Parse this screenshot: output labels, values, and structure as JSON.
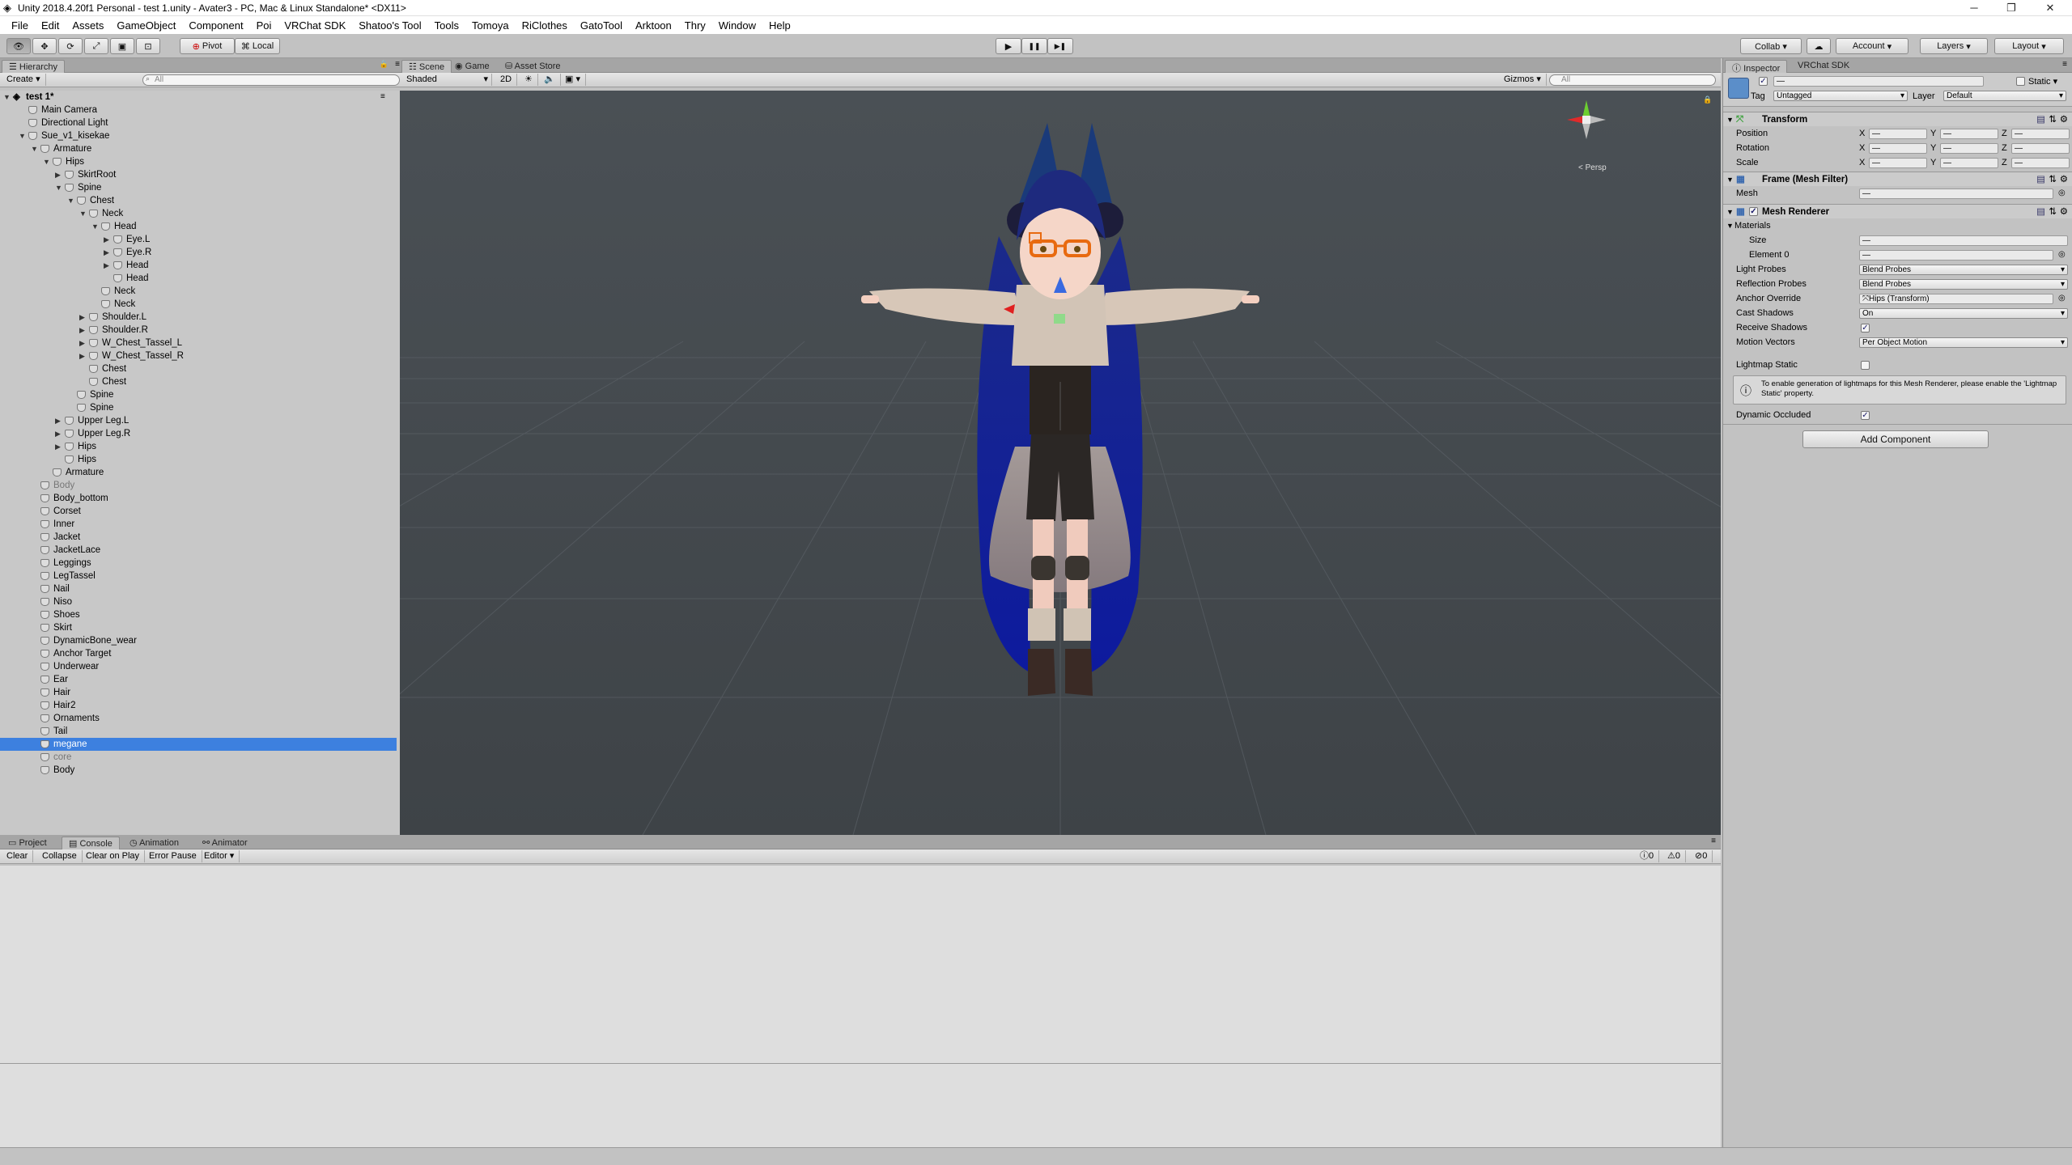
{
  "window": {
    "title": "Unity 2018.4.20f1 Personal - test 1.unity - Avater3 - PC, Mac & Linux Standalone* <DX11>",
    "minimize": "─",
    "maximize": "❐",
    "close": "✕"
  },
  "menu": [
    "File",
    "Edit",
    "Assets",
    "GameObject",
    "Component",
    "Poi",
    "VRChat SDK",
    "Shatoo's Tool",
    "Tools",
    "Tomoya",
    "RiClothes",
    "GatoTool",
    "Arktoon",
    "Thry",
    "Window",
    "Help"
  ],
  "toolbar": {
    "pivot": "Pivot",
    "local": "Local",
    "collab": "Collab ▾",
    "account": "Account",
    "layers": "Layers",
    "layout": "Layout",
    "play": "▶",
    "pause": "❚❚",
    "step": "▶❚"
  },
  "hierarchy": {
    "tab": "Hierarchy",
    "create": "Create ▾",
    "search": "All",
    "scene": "test 1*",
    "items": [
      {
        "label": "Main Camera",
        "depth": 1,
        "arrow": ""
      },
      {
        "label": "Directional Light",
        "depth": 1,
        "arrow": ""
      },
      {
        "label": "Sue_v1_kisekae",
        "depth": 1,
        "arrow": "▼"
      },
      {
        "label": "Armature",
        "depth": 2,
        "arrow": "▼"
      },
      {
        "label": "Hips",
        "depth": 3,
        "arrow": "▼"
      },
      {
        "label": "SkirtRoot",
        "depth": 4,
        "arrow": "▶"
      },
      {
        "label": "Spine",
        "depth": 4,
        "arrow": "▼"
      },
      {
        "label": "Chest",
        "depth": 5,
        "arrow": "▼"
      },
      {
        "label": "Neck",
        "depth": 6,
        "arrow": "▼"
      },
      {
        "label": "Head",
        "depth": 7,
        "arrow": "▼"
      },
      {
        "label": "Eye.L",
        "depth": 8,
        "arrow": "▶"
      },
      {
        "label": "Eye.R",
        "depth": 8,
        "arrow": "▶"
      },
      {
        "label": "Head",
        "depth": 8,
        "arrow": "▶"
      },
      {
        "label": "Head",
        "depth": 8,
        "arrow": ""
      },
      {
        "label": "Neck",
        "depth": 7,
        "arrow": ""
      },
      {
        "label": "Neck",
        "depth": 7,
        "arrow": ""
      },
      {
        "label": "Shoulder.L",
        "depth": 6,
        "arrow": "▶"
      },
      {
        "label": "Shoulder.R",
        "depth": 6,
        "arrow": "▶"
      },
      {
        "label": "W_Chest_Tassel_L",
        "depth": 6,
        "arrow": "▶"
      },
      {
        "label": "W_Chest_Tassel_R",
        "depth": 6,
        "arrow": "▶"
      },
      {
        "label": "Chest",
        "depth": 6,
        "arrow": ""
      },
      {
        "label": "Chest",
        "depth": 6,
        "arrow": ""
      },
      {
        "label": "Spine",
        "depth": 5,
        "arrow": ""
      },
      {
        "label": "Spine",
        "depth": 5,
        "arrow": ""
      },
      {
        "label": "Upper Leg.L",
        "depth": 4,
        "arrow": "▶"
      },
      {
        "label": "Upper Leg.R",
        "depth": 4,
        "arrow": "▶"
      },
      {
        "label": "Hips",
        "depth": 4,
        "arrow": "▶"
      },
      {
        "label": "Hips",
        "depth": 4,
        "arrow": ""
      },
      {
        "label": "Armature",
        "depth": 3,
        "arrow": ""
      },
      {
        "label": "Body",
        "depth": 2,
        "arrow": "",
        "dim": true
      },
      {
        "label": "Body_bottom",
        "depth": 2,
        "arrow": ""
      },
      {
        "label": "Corset",
        "depth": 2,
        "arrow": ""
      },
      {
        "label": "Inner",
        "depth": 2,
        "arrow": ""
      },
      {
        "label": "Jacket",
        "depth": 2,
        "arrow": ""
      },
      {
        "label": "JacketLace",
        "depth": 2,
        "arrow": ""
      },
      {
        "label": "Leggings",
        "depth": 2,
        "arrow": ""
      },
      {
        "label": "LegTassel",
        "depth": 2,
        "arrow": ""
      },
      {
        "label": "Nail",
        "depth": 2,
        "arrow": ""
      },
      {
        "label": "Niso",
        "depth": 2,
        "arrow": ""
      },
      {
        "label": "Shoes",
        "depth": 2,
        "arrow": ""
      },
      {
        "label": "Skirt",
        "depth": 2,
        "arrow": ""
      },
      {
        "label": "DynamicBone_wear",
        "depth": 2,
        "arrow": ""
      },
      {
        "label": "Anchor Target",
        "depth": 2,
        "arrow": ""
      },
      {
        "label": "Underwear",
        "depth": 2,
        "arrow": ""
      },
      {
        "label": "Ear",
        "depth": 2,
        "arrow": ""
      },
      {
        "label": "Hair",
        "depth": 2,
        "arrow": ""
      },
      {
        "label": "Hair2",
        "depth": 2,
        "arrow": ""
      },
      {
        "label": "Ornaments",
        "depth": 2,
        "arrow": ""
      },
      {
        "label": "Tail",
        "depth": 2,
        "arrow": ""
      },
      {
        "label": "megane",
        "depth": 2,
        "arrow": "",
        "selected": true
      },
      {
        "label": "core",
        "depth": 2,
        "arrow": "",
        "dim": true
      },
      {
        "label": "Body",
        "depth": 2,
        "arrow": ""
      }
    ]
  },
  "scene": {
    "tabs": [
      "Scene",
      "Game",
      "Asset Store"
    ],
    "shading": "Shaded",
    "mode2d": "2D",
    "gizmos": "Gizmos ▾",
    "search": "All",
    "persp": "< Persp"
  },
  "inspector": {
    "tabs": [
      "Inspector",
      "VRChat SDK"
    ],
    "name_value": "—",
    "static": "Static ▾",
    "tag_label": "Tag",
    "tag_value": "Untagged",
    "layer_label": "Layer",
    "layer_value": "Default",
    "transform": {
      "title": "Transform",
      "rows": [
        {
          "label": "Position",
          "x": "—",
          "y": "—",
          "z": "—"
        },
        {
          "label": "Rotation",
          "x": "—",
          "y": "—",
          "z": "—"
        },
        {
          "label": "Scale",
          "x": "—",
          "y": "—",
          "z": "—"
        }
      ]
    },
    "mesh_filter": {
      "title": "Frame (Mesh Filter)",
      "mesh_label": "Mesh",
      "mesh_value": "—"
    },
    "mesh_renderer": {
      "title": "Mesh Renderer",
      "materials": "Materials",
      "size_label": "Size",
      "size_value": "—",
      "element0_label": "Element 0",
      "element0_value": "—",
      "light_probes_label": "Light Probes",
      "light_probes_value": "Blend Probes",
      "reflection_probes_label": "Reflection Probes",
      "reflection_probes_value": "Blend Probes",
      "anchor_label": "Anchor Override",
      "anchor_value": "Hips (Transform)",
      "cast_label": "Cast Shadows",
      "cast_value": "On",
      "receive_label": "Receive Shadows",
      "motion_label": "Motion Vectors",
      "motion_value": "Per Object Motion",
      "lightmap_label": "Lightmap Static",
      "info": "To enable generation of lightmaps for this Mesh Renderer, please enable the 'Lightmap Static' property.",
      "occluded_label": "Dynamic Occluded"
    },
    "add_component": "Add Component"
  },
  "console": {
    "tabs": [
      "Project",
      "Console",
      "Animation",
      "Animator"
    ],
    "buttons": [
      "Clear",
      "Collapse",
      "Clear on Play",
      "Error Pause",
      "Editor ▾"
    ],
    "info_count": "0",
    "warn_count": "0",
    "error_count": "0"
  },
  "colors": {
    "selection": "#3d80df",
    "panel": "#c2c2c2",
    "scene_bg": "#444a4f",
    "hair": "#1b2a8a"
  }
}
